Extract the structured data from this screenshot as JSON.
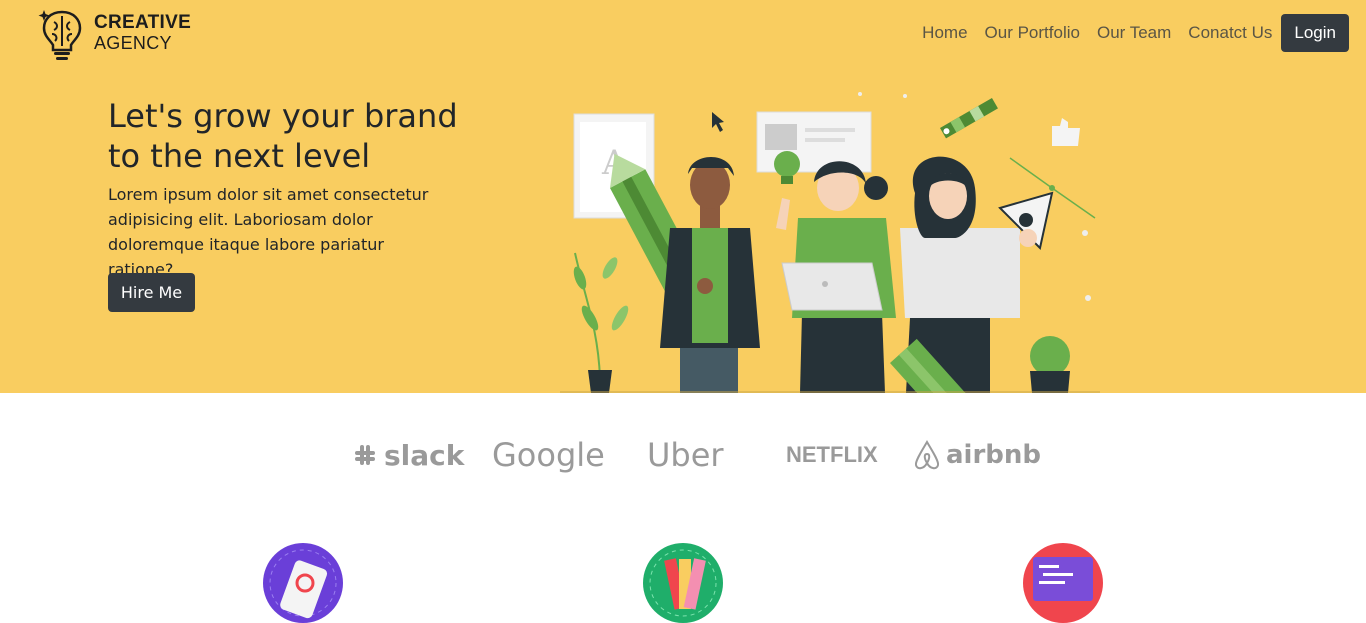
{
  "brand": {
    "line1": "CREATIVE",
    "line2": "AGENCY",
    "icon": "brain-lightbulb-icon"
  },
  "nav": {
    "items": [
      "Home",
      "Our Portfolio",
      "Our Team",
      "Conatct Us"
    ],
    "login": "Login"
  },
  "hero": {
    "headline": "Let's grow your brand to the next level",
    "description": "Lorem ipsum dolor sit amet consectetur adipisicing elit. Laboriosam dolor doloremque itaque labore pariatur ratione?",
    "cta": "Hire Me",
    "illustration": "team-designers-illustration"
  },
  "clients": [
    {
      "name": "slack",
      "icon": "slack-logo"
    },
    {
      "name": "Google",
      "icon": "google-logo"
    },
    {
      "name": "Uber",
      "icon": "uber-logo"
    },
    {
      "name": "NETFLIX",
      "icon": "netflix-logo"
    },
    {
      "name": "airbnb",
      "icon": "airbnb-logo"
    }
  ],
  "features": [
    {
      "icon": "mobile-app-icon",
      "color": "#6a3fd8"
    },
    {
      "icon": "color-palette-icon",
      "color": "#1fae6a"
    },
    {
      "icon": "code-screen-icon",
      "color": "#f0454d"
    }
  ],
  "colors": {
    "hero_bg": "#f9cd60",
    "button_bg": "#343a40",
    "accent_green": "#6aaf4c"
  }
}
